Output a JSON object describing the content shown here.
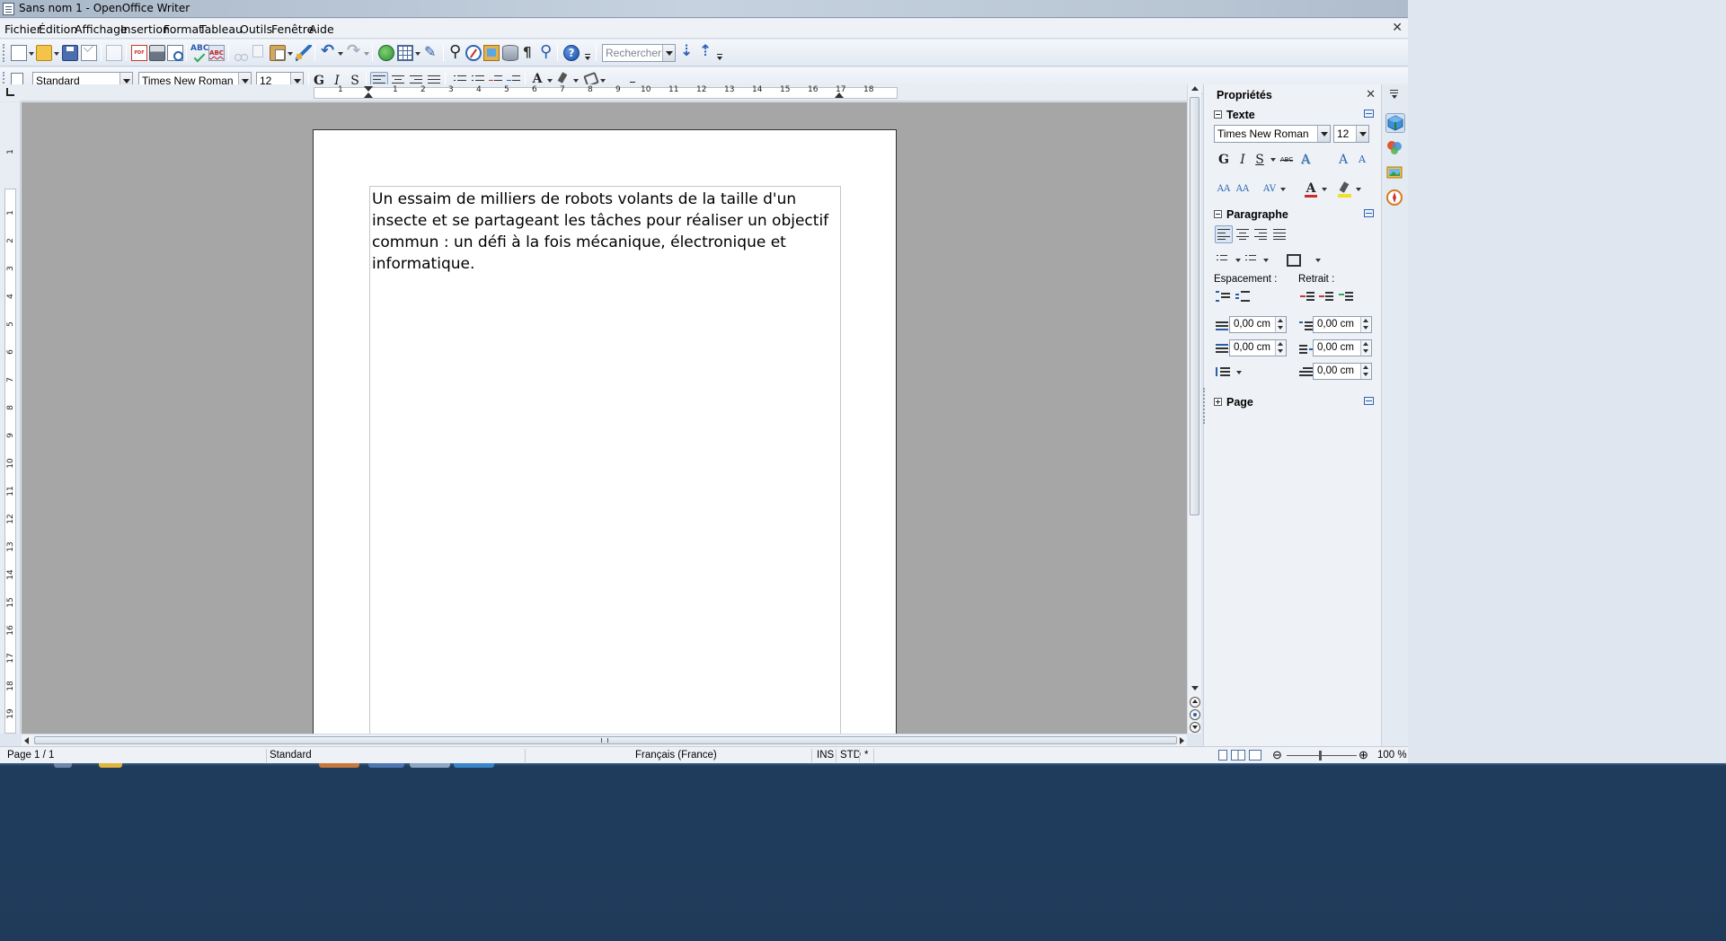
{
  "window": {
    "title": "Sans nom 1 - OpenOffice Writer",
    "min_glyph": "–",
    "max_glyph": "□",
    "close_glyph": "✕",
    "doc_close_glyph": "✕"
  },
  "menu": [
    "Fichier",
    "Édition",
    "Affichage",
    "Insertion",
    "Format",
    "Tableau",
    "Outils",
    "Fenêtre",
    "Aide"
  ],
  "toolbar": {
    "search_placeholder": "Rechercher",
    "help_glyph": "?",
    "spell_label": "ABC",
    "abc_label": "ABC"
  },
  "formatting": {
    "paragraph_style": "Standard",
    "font_name": "Times New Roman",
    "font_size": "12",
    "bold": "G",
    "italic": "I",
    "underline": "S",
    "font_color_glyph": "A"
  },
  "ruler": {
    "h_ticks": [
      "1",
      "1",
      "2",
      "3",
      "4",
      "5",
      "6",
      "7",
      "8",
      "9",
      "10",
      "11",
      "12",
      "13",
      "14",
      "15",
      "16",
      "17",
      "18"
    ],
    "v_ticks": [
      "1",
      "1",
      "2",
      "3",
      "4",
      "5",
      "6",
      "7",
      "8",
      "9",
      "10",
      "11",
      "12",
      "13",
      "14",
      "15",
      "16",
      "17",
      "18",
      "19"
    ]
  },
  "document": {
    "body": "Un essaim de milliers de robots volants de la taille d'un insecte et se partageant les tâches pour réaliser un objectif commun : un défi à la fois mécanique, électronique et informatique."
  },
  "sidebar": {
    "title": "Propriétés",
    "close_glyph": "✕",
    "text_section": {
      "title": "Texte",
      "font_name": "Times New Roman",
      "font_size": "12",
      "bold": "G",
      "italic": "I",
      "underline": "S",
      "strike": "ABC",
      "shadow": "A",
      "grow": "A",
      "shrink": "A",
      "superscript": "AA",
      "subscript": "AA",
      "char_spacing": "AV",
      "font_color": "A",
      "highlight": "ab"
    },
    "paragraph_section": {
      "title": "Paragraphe",
      "spacing_label": "Espacement :",
      "indent_label": "Retrait :",
      "above": "0,00 cm",
      "below": "0,00 cm",
      "indent_before": "0,00 cm",
      "indent_after": "0,00 cm",
      "first_line": "0,00 cm"
    },
    "page_section": {
      "title": "Page"
    }
  },
  "statusbar": {
    "page": "Page 1 / 1",
    "style": "Standard",
    "language": "Français (France)",
    "insert_mode": "INS",
    "selection_mode": "STD",
    "modified": "*",
    "zoom": "100 %",
    "zoom_out": "⊖",
    "zoom_in": "⊕"
  },
  "colors": {
    "font_color": "#d32b2b",
    "highlight": "#f2e12a",
    "accent": "#2d64b4"
  }
}
